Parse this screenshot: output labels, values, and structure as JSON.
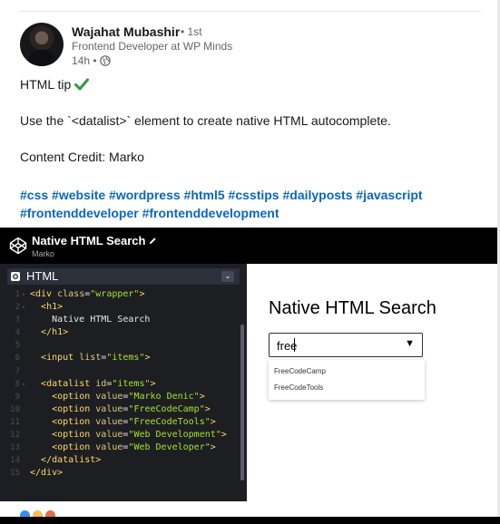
{
  "author": {
    "name": "Wajahat Mubashir",
    "degree": "• 1st",
    "headline": "Frontend Developer at WP Minds",
    "time": "14h •"
  },
  "post": {
    "line1": "HTML tip",
    "line2": "Use the `<datalist>` element to create native HTML autocomplete.",
    "line3": "Content Credit: Marko",
    "hashtags": "#css #website #wordpress #html5 #csstips #dailyposts #javascript #frontenddeveloper #frontenddevelopment"
  },
  "pen": {
    "title": "Native HTML Search",
    "author": "Marko",
    "editor_label": "HTML",
    "code": [
      {
        "n": "1",
        "fold": "▾",
        "html": "<div class=\"wrapper\">"
      },
      {
        "n": "2",
        "fold": "▾",
        "html": "  <h1>"
      },
      {
        "n": "3",
        "fold": "",
        "html": "    Native HTML Search"
      },
      {
        "n": "4",
        "fold": "",
        "html": "  </h1>"
      },
      {
        "n": "5",
        "fold": "",
        "html": ""
      },
      {
        "n": "6",
        "fold": "",
        "html": "  <input list=\"items\">"
      },
      {
        "n": "7",
        "fold": "",
        "html": ""
      },
      {
        "n": "8",
        "fold": "▾",
        "html": "  <datalist id=\"items\">"
      },
      {
        "n": "9",
        "fold": "",
        "html": "    <option value=\"Marko Denic\">"
      },
      {
        "n": "10",
        "fold": "",
        "html": "    <option value=\"FreeCodeCamp\">"
      },
      {
        "n": "11",
        "fold": "",
        "html": "    <option value=\"FreeCodeTools\">"
      },
      {
        "n": "12",
        "fold": "",
        "html": "    <option value=\"Web Development\">"
      },
      {
        "n": "13",
        "fold": "",
        "html": "    <option value=\"Web Developer\">"
      },
      {
        "n": "14",
        "fold": "",
        "html": "  </datalist>"
      },
      {
        "n": "15",
        "fold": "",
        "html": "</div>"
      }
    ],
    "preview": {
      "title": "Native HTML Search",
      "input_value": "free",
      "suggestions": [
        "FreeCodeCamp",
        "FreeCodeTools"
      ]
    }
  },
  "colors": {
    "link": "#0a66c2",
    "check": "#2e9b3f",
    "code_bg": "#1d1e22"
  }
}
